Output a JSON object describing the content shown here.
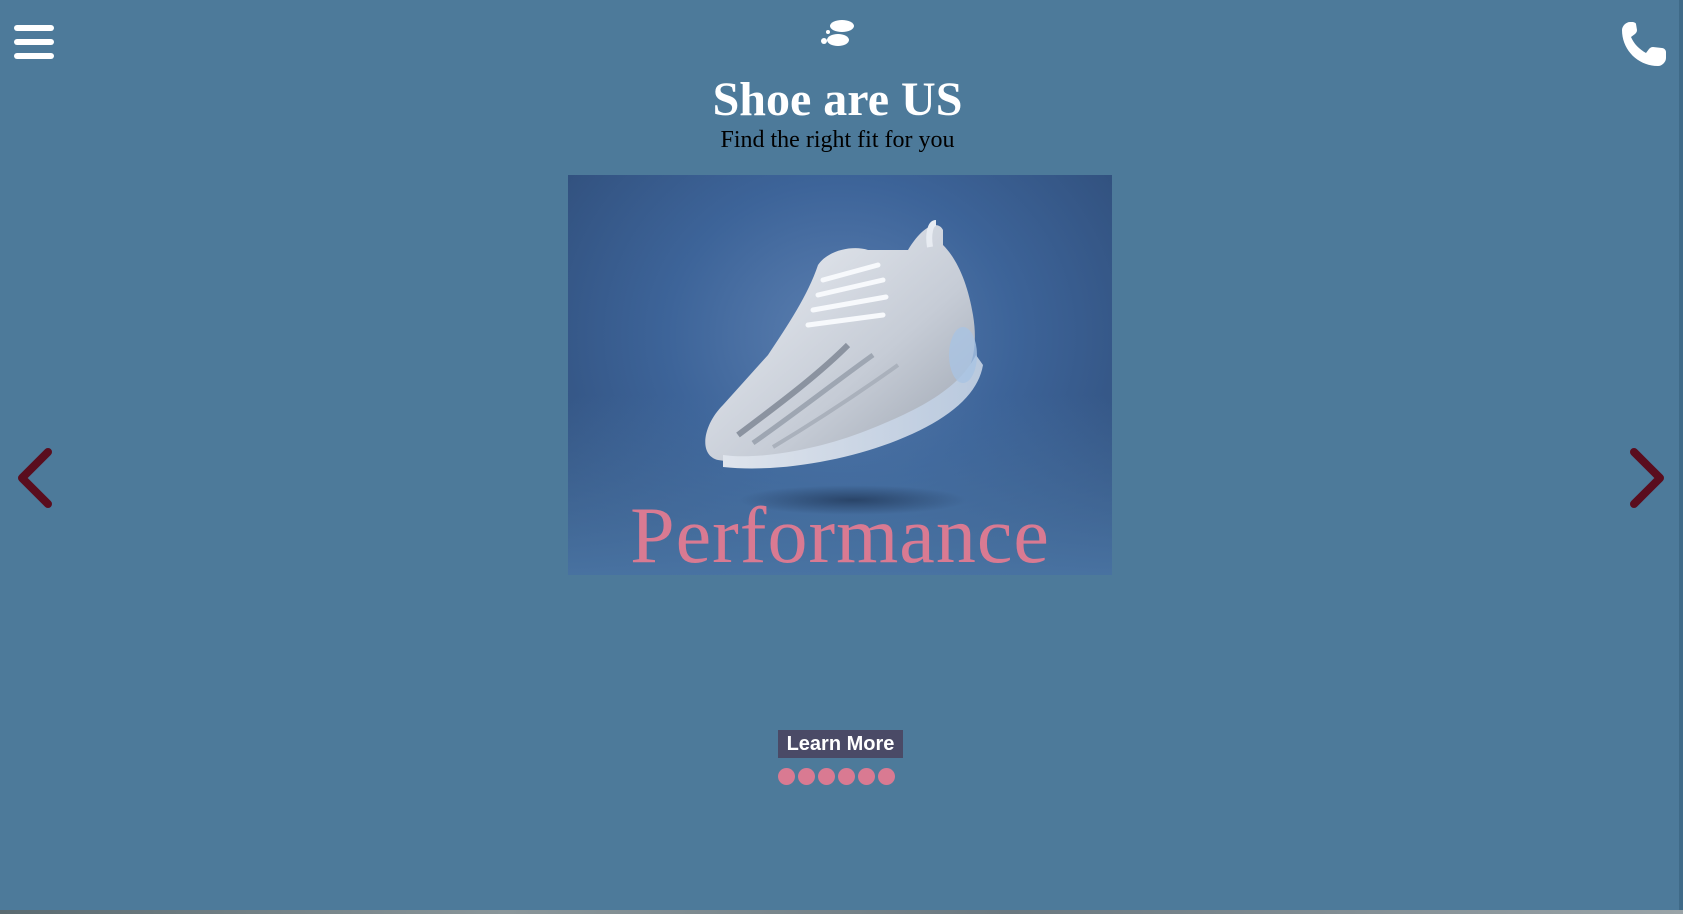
{
  "header": {
    "menu_icon": "hamburger-menu-icon",
    "logo_icon": "footprint-logo-icon",
    "phone_icon": "phone-icon",
    "title": "Shoe are US",
    "tagline": "Find the right fit for you"
  },
  "carousel": {
    "current_slide_caption": "Performance",
    "prev_icon": "chevron-left-icon",
    "next_icon": "chevron-right-icon",
    "dot_count": 6,
    "cta_label": "Learn More"
  },
  "colors": {
    "background": "#4d7a9a",
    "accent_pink": "#d97a92",
    "arrow_maroon": "#5a0d1e",
    "button_bg": "#4a4a66"
  }
}
